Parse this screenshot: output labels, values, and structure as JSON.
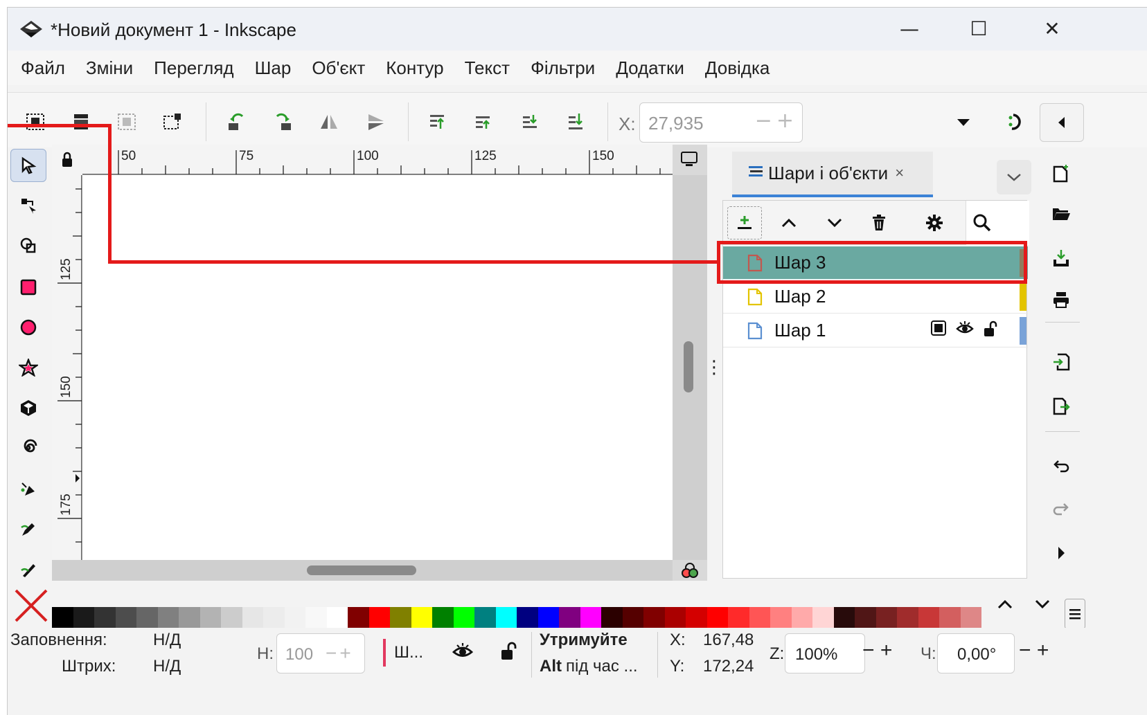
{
  "window": {
    "title": "*Новий документ 1 - Inkscape",
    "minimize_glyph": "—",
    "maximize_glyph": "☐",
    "close_glyph": "✕"
  },
  "menu": [
    "Файл",
    "Зміни",
    "Перегляд",
    "Шар",
    "Об'єкт",
    "Контур",
    "Текст",
    "Фільтри",
    "Додатки",
    "Довідка"
  ],
  "toolbar": {
    "x_label": "X:",
    "x_value": "27,935",
    "x_buttons": "−+"
  },
  "ruler": {
    "top": [
      "50",
      "75",
      "100",
      "125",
      "150"
    ],
    "left": [
      "125",
      "150",
      "175"
    ]
  },
  "panel": {
    "tab_label": "Шари і об'єкти",
    "tab_close": "×",
    "layers": [
      {
        "name": "Шар 3",
        "selected": true,
        "color": "#c2584f",
        "strip": "#8f7d5d"
      },
      {
        "name": "Шар 2",
        "selected": false,
        "color": "#e3c400",
        "strip": "#e3c400"
      },
      {
        "name": "Шар 1",
        "selected": false,
        "color": "#5b8fd1",
        "strip": "#7aa3d8"
      }
    ]
  },
  "palette_colors": [
    "#000000",
    "#1a1a1a",
    "#333333",
    "#4d4d4d",
    "#666666",
    "#808080",
    "#999999",
    "#b3b3b3",
    "#cccccc",
    "#e6e6e6",
    "#ececec",
    "#f2f2f2",
    "#f8f8f8",
    "#ffffff",
    "#800000",
    "#ff0000",
    "#808000",
    "#ffff00",
    "#008000",
    "#00ff00",
    "#008080",
    "#00ffff",
    "#000080",
    "#0000ff",
    "#800080",
    "#ff00ff",
    "#2b0000",
    "#550000",
    "#800000",
    "#aa0000",
    "#d40000",
    "#ff0000",
    "#ff2a2a",
    "#ff5555",
    "#ff8080",
    "#ffaaaa",
    "#ffd5d5",
    "#280b0b",
    "#501616",
    "#782121",
    "#a02c2c",
    "#c83737",
    "#d35f5f",
    "#de8787"
  ],
  "status": {
    "fill_label": "Заповнення:",
    "fill_value": "Н/Д",
    "stroke_label": "Штрих:",
    "stroke_value": "Н/Д",
    "opacity_label": "Н:",
    "opacity_value": "100",
    "opacity_buttons": "−+",
    "layer_short": "Ш...",
    "hint_bold": "Утримуйте",
    "hint_line2_bold": "Alt",
    "hint_line2": " під час ...",
    "x_label": "X:",
    "x_value": "167,48",
    "y_label": "Y:",
    "y_value": "172,24",
    "zoom_label": "Z:",
    "zoom_value": "100%",
    "zoom_buttons": "− +",
    "rotate_label": "Ч:",
    "rotate_value": "0,00°",
    "rotate_buttons": "− +"
  }
}
